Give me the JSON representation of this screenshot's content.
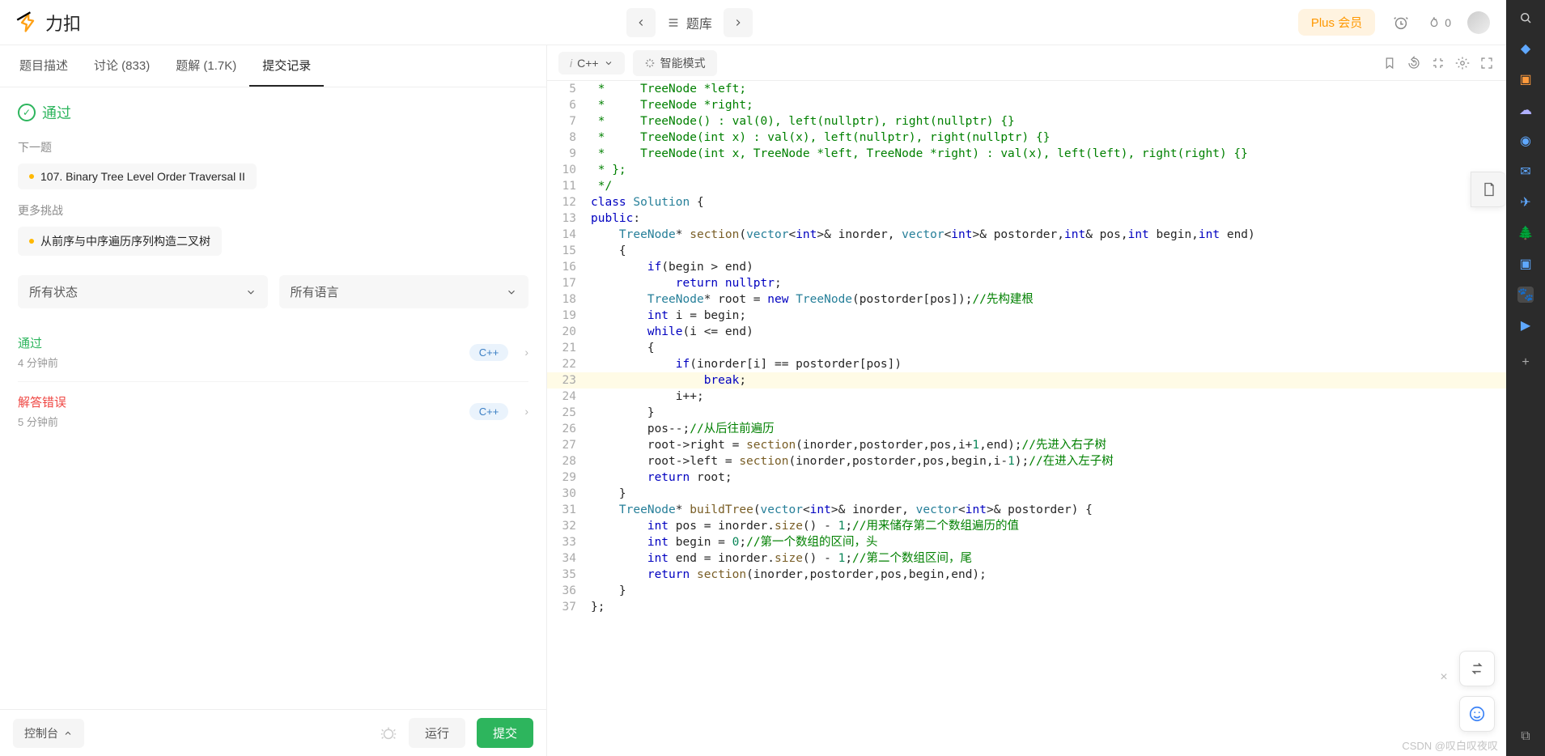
{
  "logo_text": "力扣",
  "header": {
    "problems_label": "题库",
    "plus_label": "Plus 会员",
    "fire_count": "0"
  },
  "tabs": {
    "desc": "题目描述",
    "discuss": "讨论 (833)",
    "solutions": "题解 (1.7K)",
    "submissions": "提交记录"
  },
  "panel": {
    "pass": "通过",
    "next_label": "下一题",
    "next_problem": "107. Binary Tree Level Order Traversal II",
    "more_label": "更多挑战",
    "more_problem": "从前序与中序遍历序列构造二叉树",
    "filter_status": "所有状态",
    "filter_lang": "所有语言"
  },
  "subs": [
    {
      "status": "通过",
      "time": "4 分钟前",
      "lang": "C++",
      "cls": "pass"
    },
    {
      "status": "解答错误",
      "time": "5 分钟前",
      "lang": "C++",
      "cls": "err"
    }
  ],
  "footer": {
    "console": "控制台",
    "run": "运行",
    "submit": "提交"
  },
  "editor_top": {
    "lang": "C++",
    "mode": "智能模式"
  },
  "code": [
    {
      "n": 5,
      "html": "<span class='com'> *     TreeNode *left;</span>",
      "pad": 0
    },
    {
      "n": 6,
      "html": "<span class='com'> *     TreeNode *right;</span>",
      "pad": 0
    },
    {
      "n": 7,
      "html": "<span class='com'> *     TreeNode() : val(0), left(nullptr), right(nullptr) {}</span>",
      "pad": 0
    },
    {
      "n": 8,
      "html": "<span class='com'> *     TreeNode(int x) : val(x), left(nullptr), right(nullptr) {}</span>",
      "pad": 0
    },
    {
      "n": 9,
      "html": "<span class='com'> *     TreeNode(int x, TreeNode *left, TreeNode *right) : val(x), left(left), right(right) {}</span>",
      "pad": 0
    },
    {
      "n": 10,
      "html": "<span class='com'> * };</span>",
      "pad": 0
    },
    {
      "n": 11,
      "html": "<span class='com'> */</span>",
      "pad": 0
    },
    {
      "n": 12,
      "html": "<span class='kw'>class</span> <span class='cls'>Solution</span> {",
      "pad": 0
    },
    {
      "n": 13,
      "html": "<span class='kw'>public</span>:",
      "pad": 0
    },
    {
      "n": 14,
      "html": "    <span class='cls'>TreeNode</span>* <span class='fn'>section</span>(<span class='cls'>vector</span>&lt;<span class='kw'>int</span>&gt;&amp; inorder, <span class='cls'>vector</span>&lt;<span class='kw'>int</span>&gt;&amp; postorder,<span class='kw'>int</span>&amp; pos,<span class='kw'>int</span> begin,<span class='kw'>int</span> end)",
      "pad": 0
    },
    {
      "n": 15,
      "html": "    {",
      "pad": 0
    },
    {
      "n": 16,
      "html": "        <span class='kw'>if</span>(begin &gt; end)",
      "pad": 0
    },
    {
      "n": 17,
      "html": "            <span class='kw'>return</span> <span class='kw'>nullptr</span>;",
      "pad": 0
    },
    {
      "n": 18,
      "html": "        <span class='cls'>TreeNode</span>* root = <span class='kw'>new</span> <span class='cls'>TreeNode</span>(postorder[pos]);<span class='com'>//先构建根</span>",
      "pad": 0
    },
    {
      "n": 19,
      "html": "        <span class='kw'>int</span> i = begin;",
      "pad": 0
    },
    {
      "n": 20,
      "html": "        <span class='kw'>while</span>(i &lt;= end)",
      "pad": 0
    },
    {
      "n": 21,
      "html": "        {",
      "pad": 0
    },
    {
      "n": 22,
      "html": "            <span class='kw'>if</span>(inorder[i] == postorder[pos])",
      "pad": 0
    },
    {
      "n": 23,
      "html": "                <span class='kw'>break</span>;",
      "pad": 0,
      "hl": true
    },
    {
      "n": 24,
      "html": "            i++;",
      "pad": 0
    },
    {
      "n": 25,
      "html": "        }",
      "pad": 0
    },
    {
      "n": 26,
      "html": "        pos--;<span class='com'>//从后往前遍历</span>",
      "pad": 0
    },
    {
      "n": 27,
      "html": "        root-&gt;right = <span class='fn'>section</span>(inorder,postorder,pos,i+<span class='num'>1</span>,end);<span class='com'>//先进入右子树</span>",
      "pad": 0
    },
    {
      "n": 28,
      "html": "        root-&gt;left = <span class='fn'>section</span>(inorder,postorder,pos,begin,i-<span class='num'>1</span>);<span class='com'>//在进入左子树</span>",
      "pad": 0
    },
    {
      "n": 29,
      "html": "        <span class='kw'>return</span> root;",
      "pad": 0
    },
    {
      "n": 30,
      "html": "    }",
      "pad": 0
    },
    {
      "n": 31,
      "html": "    <span class='cls'>TreeNode</span>* <span class='fn'>buildTree</span>(<span class='cls'>vector</span>&lt;<span class='kw'>int</span>&gt;&amp; inorder, <span class='cls'>vector</span>&lt;<span class='kw'>int</span>&gt;&amp; postorder) {",
      "pad": 0
    },
    {
      "n": 32,
      "html": "        <span class='kw'>int</span> pos = inorder.<span class='fn'>size</span>() - <span class='num'>1</span>;<span class='com'>//用来储存第二个数组遍历的值</span>",
      "pad": 0
    },
    {
      "n": 33,
      "html": "        <span class='kw'>int</span> begin = <span class='num'>0</span>;<span class='com'>//第一个数组的区间，头</span>",
      "pad": 0
    },
    {
      "n": 34,
      "html": "        <span class='kw'>int</span> end = inorder.<span class='fn'>size</span>() - <span class='num'>1</span>;<span class='com'>//第二个数组区间，尾</span>",
      "pad": 0
    },
    {
      "n": 35,
      "html": "        <span class='kw'>return</span> <span class='fn'>section</span>(inorder,postorder,pos,begin,end);",
      "pad": 0
    },
    {
      "n": 36,
      "html": "    }",
      "pad": 0
    },
    {
      "n": 37,
      "html": "};",
      "pad": 0
    }
  ],
  "watermark": "CSDN @叹白叹夜叹"
}
